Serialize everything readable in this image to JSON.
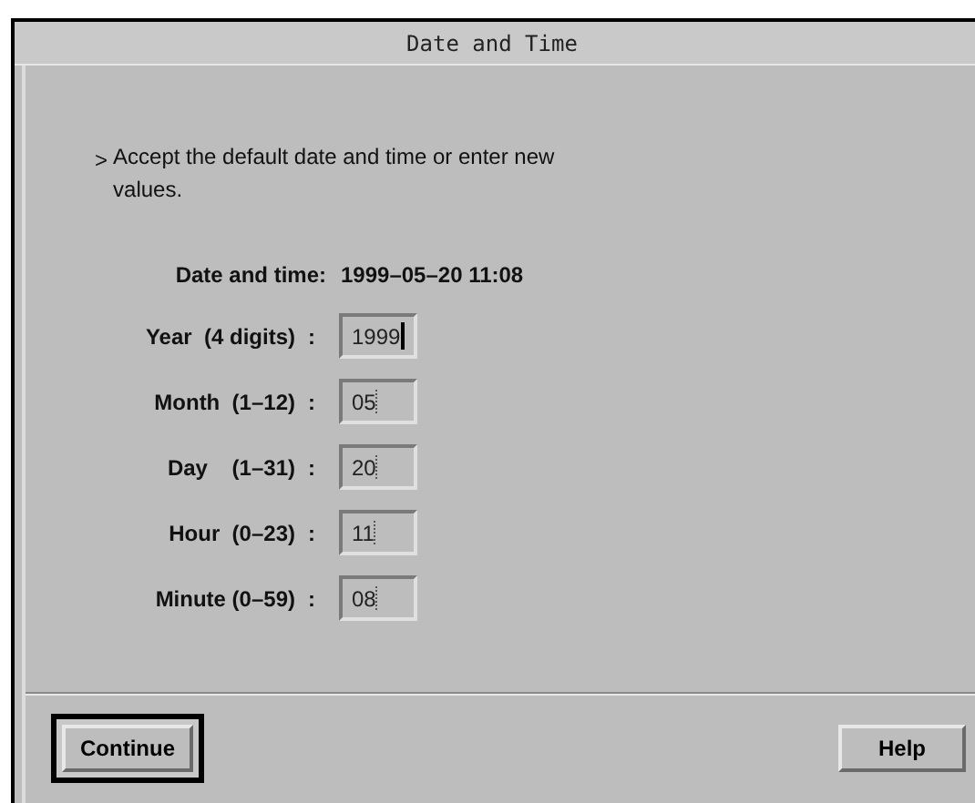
{
  "window": {
    "title": "Date and Time"
  },
  "instruction": {
    "marker": ">",
    "text": "Accept the default date and time or enter new values."
  },
  "current": {
    "label": "Date and time:",
    "value": "1999–05–20 11:08"
  },
  "fields": [
    {
      "label": "Year  (4 digits)",
      "colon": ":",
      "value": "1999",
      "focused": true
    },
    {
      "label": "Month  (1–12)",
      "colon": ":",
      "value": "05",
      "focused": false
    },
    {
      "label": "Day    (1–31)",
      "colon": ":",
      "value": "20",
      "focused": false
    },
    {
      "label": "Hour  (0–23)",
      "colon": ":",
      "value": "11",
      "focused": false
    },
    {
      "label": "Minute (0–59)",
      "colon": ":",
      "value": "08",
      "focused": false
    }
  ],
  "buttons": [
    {
      "label": "Continue",
      "default": true
    },
    {
      "label": "Help",
      "default": false
    }
  ]
}
